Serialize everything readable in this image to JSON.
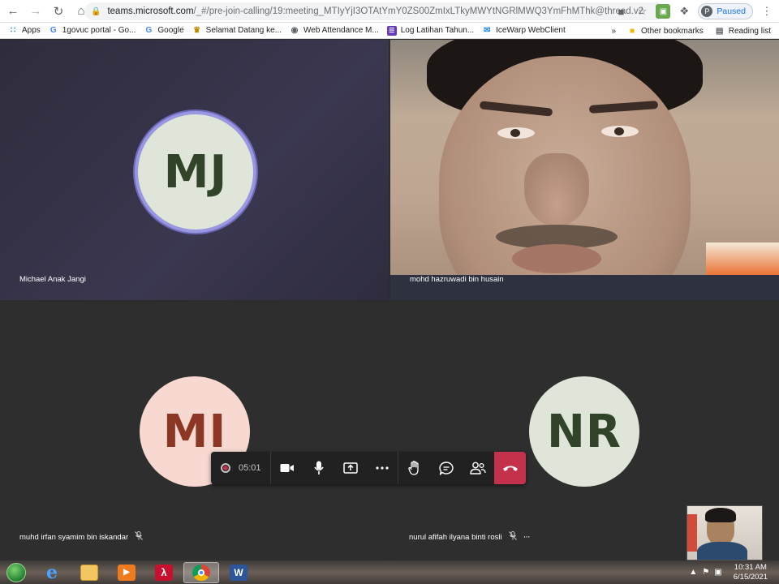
{
  "browser": {
    "url_host": "teams.microsoft.com",
    "url_path": "/_#/pre-join-calling/19:meeting_MTIyYjI3OTAtYmY0ZS00ZmIxLTkyMWYtNGRlMWQ3YmFhMThk@thread.v2",
    "profile_status": "Paused",
    "avatar_initial": "P"
  },
  "bookmarks": {
    "items": [
      {
        "label": "Apps",
        "icon": "apps-grid-icon"
      },
      {
        "label": "1govuc portal - Go...",
        "icon": "google-icon"
      },
      {
        "label": "Google",
        "icon": "google-icon"
      },
      {
        "label": "Selamat Datang ke...",
        "icon": "crest-icon"
      },
      {
        "label": "Web Attendance M...",
        "icon": "globe-icon"
      },
      {
        "label": "Log Latihan Tahun...",
        "icon": "form-icon"
      },
      {
        "label": "IceWarp WebClient",
        "icon": "mail-icon"
      }
    ],
    "overflow": "»",
    "other": "Other bookmarks",
    "reading_list": "Reading list"
  },
  "participants": [
    {
      "initials": "MJ",
      "name": "Michael Anak Jangi",
      "muted": false,
      "video": false
    },
    {
      "initials": "",
      "name": "mohd hazruwadi bin husain",
      "muted": false,
      "video": true
    },
    {
      "initials": "MI",
      "name": "muhd irfan syamim bin iskandar",
      "muted": true,
      "video": false
    },
    {
      "initials": "NR",
      "name": "nurul afifah ilyana binti rosli",
      "muted": true,
      "video": false
    }
  ],
  "more_options": "···",
  "call_controls": {
    "timer": "05:01",
    "buttons": [
      "camera",
      "microphone",
      "share",
      "more",
      "raise-hand",
      "chat",
      "participants",
      "hang-up"
    ]
  },
  "taskbar": {
    "time": "10:31 AM",
    "date": "6/15/2021",
    "apps": [
      "internet-explorer",
      "file-explorer",
      "media-player",
      "acrobat-reader",
      "chrome",
      "word"
    ]
  },
  "colors": {
    "teams_dark": "#2d2c2c",
    "hangup_red": "#c4314b",
    "ring_purple": "#9a97e0",
    "mj_bg": "#dfe5d8",
    "mi_bg": "#f8d9d2"
  }
}
